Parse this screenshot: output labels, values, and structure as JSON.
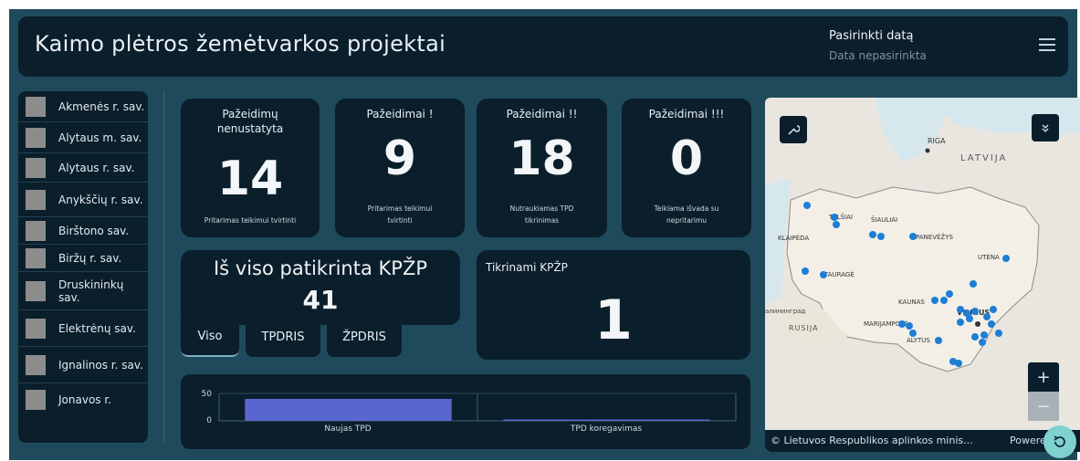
{
  "header": {
    "title": "Kaimo plėtros žemėtvarkos projektai",
    "date_label": "Pasirinkti datą",
    "date_value": "Data nepasirinkta"
  },
  "sidebar": {
    "items": [
      {
        "label": "Akmenės r. sav."
      },
      {
        "label": "Alytaus m. sav."
      },
      {
        "label": "Alytaus r. sav."
      },
      {
        "label": "Anykščių r. sav."
      },
      {
        "label": "Birštono sav."
      },
      {
        "label": "Biržų r. sav."
      },
      {
        "label": "Druskininkų sav."
      },
      {
        "label": "Elektrėnų sav."
      },
      {
        "label": "Ignalinos r. sav."
      },
      {
        "label": "Jonavos r."
      }
    ]
  },
  "cards": [
    {
      "title": "Pažeidimų nenustatyta",
      "value": "14",
      "subtitle": "Pritarimas teikimui tvirtinti"
    },
    {
      "title": "Pažeidimai !",
      "value": "9",
      "subtitle": "Pritarimas teikimui tvirtinti"
    },
    {
      "title": "Pažeidimai !!",
      "value": "18",
      "subtitle": "Nutraukiamas TPD tikrinimas"
    },
    {
      "title": "Pažeidimai !!!",
      "value": "0",
      "subtitle": "Teikiama išvada su nepritarimu"
    }
  ],
  "total": {
    "label": "Iš viso patikrinta KPŽP",
    "value": "41"
  },
  "checking": {
    "label": "Tikrinami KPŽP",
    "value": "1"
  },
  "tabs": [
    "Viso",
    "TPDRIS",
    "ŽPDRIS"
  ],
  "chart_data": {
    "type": "bar",
    "categories": [
      "Naujas TPD",
      "TPD koregavimas"
    ],
    "values": [
      40,
      1
    ],
    "ylim": [
      0,
      50
    ],
    "yticks": [
      "50",
      "0"
    ],
    "bar_color": "#5a66d0",
    "title": "",
    "xlabel": "",
    "ylabel": ""
  },
  "map": {
    "labels": {
      "latvija": "LATVIJA",
      "riga": "RIGA",
      "klaipeda": "KLAIPĖDA",
      "siauliai": "ŠIAULIAI",
      "telsiai": "TELŠIAI",
      "panevezys": "PANEVĖŽYS",
      "utena": "UTENA",
      "taurage": "TAURAGĖ",
      "kaunas": "KAUNAS",
      "vilnius": "VILNIUS",
      "marijampole": "MARIJAMPOLĖ",
      "alytus": "ALYTUS",
      "kaliningrad": "алининград",
      "rusija": "RUSIJA"
    },
    "attribution": "© Lietuvos Respublikos aplinkos minis...",
    "powered": "Powered by",
    "zoom_in": "+",
    "zoom_out": "−",
    "colors": {
      "marker": "#1c7ed6",
      "land": "#f3efe6",
      "sea": "#d7e7ee"
    }
  }
}
